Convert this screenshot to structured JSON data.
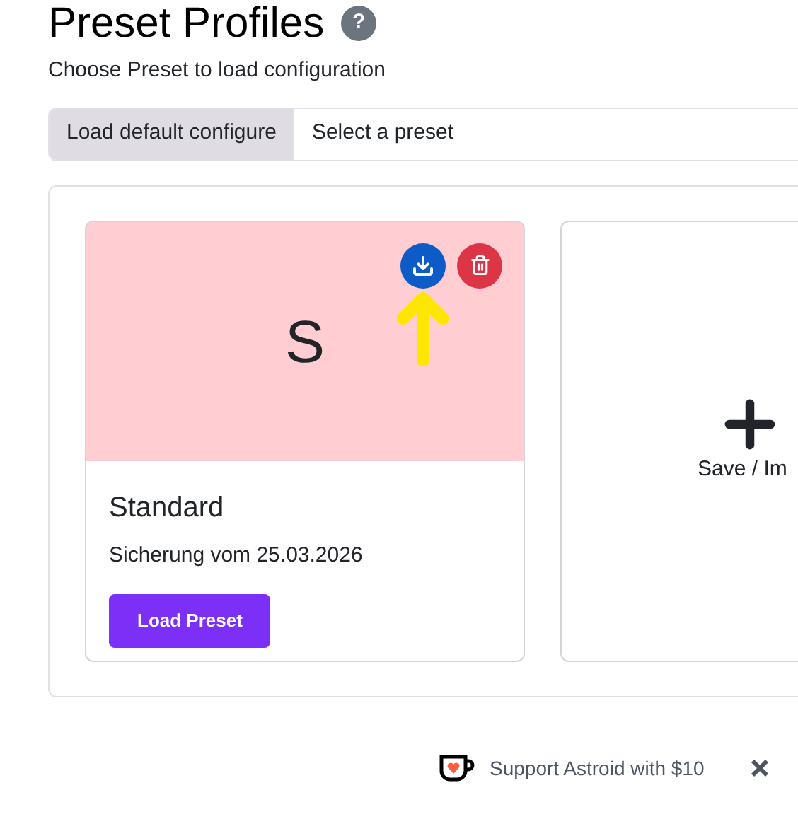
{
  "title": "Preset Profiles",
  "help": "?",
  "subtitle": "Choose Preset to load configuration",
  "preset_select": {
    "label": "Load default configure",
    "placeholder": "Select a preset"
  },
  "presets": [
    {
      "kind": "preset",
      "initial": "S",
      "name": "Standard",
      "description": "Sicherung vom 25.03.2026",
      "button": "Load Preset",
      "highlighted_download": true
    },
    {
      "kind": "add",
      "label": "Save / Im"
    }
  ],
  "footer": {
    "support": "Support Astroid with $10"
  }
}
